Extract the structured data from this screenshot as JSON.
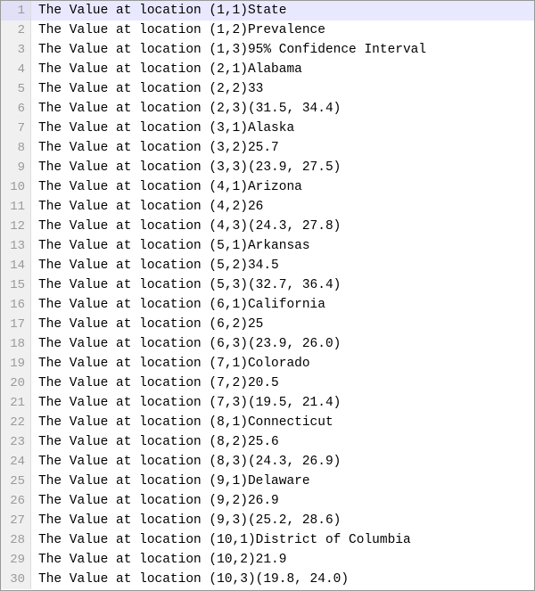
{
  "chart_data": {
    "type": "table",
    "columns": [
      "State",
      "Prevalence",
      "95% Confidence Interval"
    ],
    "rows": [
      [
        "Alabama",
        33,
        "(31.5, 34.4)"
      ],
      [
        "Alaska",
        25.7,
        "(23.9, 27.5)"
      ],
      [
        "Arizona",
        26,
        "(24.3, 27.8)"
      ],
      [
        "Arkansas",
        34.5,
        "(32.7, 36.4)"
      ],
      [
        "California",
        25,
        "(23.9, 26.0)"
      ],
      [
        "Colorado",
        20.5,
        "(19.5, 21.4)"
      ],
      [
        "Connecticut",
        25.6,
        "(24.3, 26.9)"
      ],
      [
        "Delaware",
        26.9,
        "(25.2, 28.6)"
      ],
      [
        "District of Columbia",
        21.9,
        "(19.8, 24.0)"
      ]
    ]
  },
  "editor": {
    "current_line": 1,
    "template_prefix": "The Value at location ",
    "lines": [
      {
        "n": 1,
        "text": "The Value at location (1,1)State"
      },
      {
        "n": 2,
        "text": "The Value at location (1,2)Prevalence"
      },
      {
        "n": 3,
        "text": "The Value at location (1,3)95% Confidence Interval"
      },
      {
        "n": 4,
        "text": "The Value at location (2,1)Alabama"
      },
      {
        "n": 5,
        "text": "The Value at location (2,2)33"
      },
      {
        "n": 6,
        "text": "The Value at location (2,3)(31.5, 34.4)"
      },
      {
        "n": 7,
        "text": "The Value at location (3,1)Alaska"
      },
      {
        "n": 8,
        "text": "The Value at location (3,2)25.7"
      },
      {
        "n": 9,
        "text": "The Value at location (3,3)(23.9, 27.5)"
      },
      {
        "n": 10,
        "text": "The Value at location (4,1)Arizona"
      },
      {
        "n": 11,
        "text": "The Value at location (4,2)26"
      },
      {
        "n": 12,
        "text": "The Value at location (4,3)(24.3, 27.8)"
      },
      {
        "n": 13,
        "text": "The Value at location (5,1)Arkansas"
      },
      {
        "n": 14,
        "text": "The Value at location (5,2)34.5"
      },
      {
        "n": 15,
        "text": "The Value at location (5,3)(32.7, 36.4)"
      },
      {
        "n": 16,
        "text": "The Value at location (6,1)California"
      },
      {
        "n": 17,
        "text": "The Value at location (6,2)25"
      },
      {
        "n": 18,
        "text": "The Value at location (6,3)(23.9, 26.0)"
      },
      {
        "n": 19,
        "text": "The Value at location (7,1)Colorado"
      },
      {
        "n": 20,
        "text": "The Value at location (7,2)20.5"
      },
      {
        "n": 21,
        "text": "The Value at location (7,3)(19.5, 21.4)"
      },
      {
        "n": 22,
        "text": "The Value at location (8,1)Connecticut"
      },
      {
        "n": 23,
        "text": "The Value at location (8,2)25.6"
      },
      {
        "n": 24,
        "text": "The Value at location (8,3)(24.3, 26.9)"
      },
      {
        "n": 25,
        "text": "The Value at location (9,1)Delaware"
      },
      {
        "n": 26,
        "text": "The Value at location (9,2)26.9"
      },
      {
        "n": 27,
        "text": "The Value at location (9,3)(25.2, 28.6)"
      },
      {
        "n": 28,
        "text": "The Value at location (10,1)District of Columbia"
      },
      {
        "n": 29,
        "text": "The Value at location (10,2)21.9"
      },
      {
        "n": 30,
        "text": "The Value at location (10,3)(19.8, 24.0)"
      }
    ]
  }
}
